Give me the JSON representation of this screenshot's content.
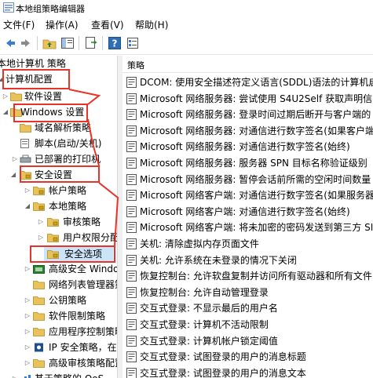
{
  "window": {
    "title": "本地组策略编辑器",
    "icon": "gpedit-icon"
  },
  "menu": [
    "文件(F)",
    "操作(A)",
    "查看(V)",
    "帮助(H)"
  ],
  "toolbar_icons": [
    "back-icon",
    "forward-icon",
    "up-folder-icon",
    "show-hide-tree-icon",
    "export-list-icon",
    "help-icon",
    "properties-icon"
  ],
  "tree": {
    "root": "本地计算机 策略",
    "items": [
      {
        "label": "计算机配置"
      },
      {
        "label": "软件设置"
      },
      {
        "label": "Windows 设置"
      },
      {
        "label": "域名解析策略"
      },
      {
        "label": "脚本(启动/关机)"
      },
      {
        "label": "已部署的打印机"
      },
      {
        "label": "安全设置"
      },
      {
        "label": "帐户策略"
      },
      {
        "label": "本地策略"
      },
      {
        "label": "审核策略"
      },
      {
        "label": "用户权限分配"
      },
      {
        "label": "安全选项"
      },
      {
        "label": "高级安全 Windows"
      },
      {
        "label": "网络列表管理器策略"
      },
      {
        "label": "公钥策略"
      },
      {
        "label": "软件限制策略"
      },
      {
        "label": "应用程序控制策略"
      },
      {
        "label": "IP 安全策略，在"
      },
      {
        "label": "高级审核策略配置"
      },
      {
        "label": "基于策略的 QoS"
      }
    ]
  },
  "list": {
    "header": "策略",
    "rows": [
      "DCOM: 使用安全描述符定义语言(SDDL)语法的计算机启",
      "Microsoft 网络服务器: 尝试使用 S4U2Self 获取声明信",
      "Microsoft 网络服务器: 登录时间过期后断开与客户端的",
      "Microsoft 网络服务器: 对通信进行数字签名(如果客户端",
      "Microsoft 网络服务器: 对通信进行数字签名(始终)",
      "Microsoft 网络服务器: 服务器 SPN 目标名称验证级别",
      "Microsoft 网络服务器: 暂停会话前所需的空闲时间数量",
      "Microsoft 网络客户端: 对通信进行数字签名(如果服务器",
      "Microsoft 网络客户端: 对通信进行数字签名(始终)",
      "Microsoft 网络客户端: 将未加密的密码发送到第三方 SI",
      "关机: 清除虚拟内存页面文件",
      "关机: 允许系统在未登录的情况下关闭",
      "恢复控制台: 允许软盘复制并访问所有驱动器和所有文件",
      "恢复控制台: 允许自动管理登录",
      "交互式登录: 不显示最后的用户名",
      "交互式登录: 计算机不活动限制",
      "交互式登录: 计算机帐户锁定阈值",
      "交互式登录: 试图登录的用户的消息标题",
      "交互式登录: 试图登录的用户的消息文本"
    ]
  },
  "colors": {
    "annotation": "#e8332a",
    "folder": "#e8c25b",
    "selection": "#cce4f7"
  }
}
